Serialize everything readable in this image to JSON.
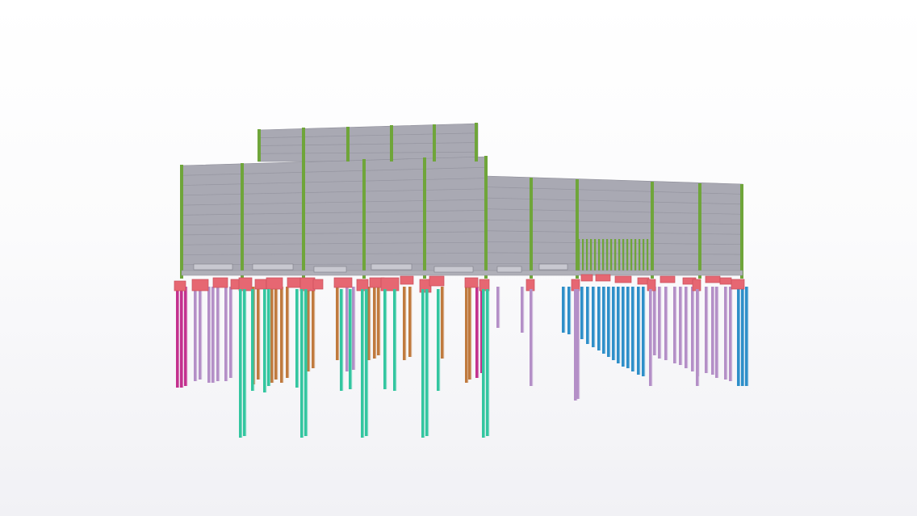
{
  "viewport": {
    "background_top": "#ffffff",
    "background_bottom": "#f1f1f5"
  },
  "model": {
    "elements": [
      {
        "name": "wall-panel",
        "color": "#a9a9b3"
      },
      {
        "name": "wall-panel-edge",
        "color": "#8d8d98"
      },
      {
        "name": "steel-column",
        "color": "#6fa53a"
      },
      {
        "name": "pile-cap",
        "color": "#e66772"
      },
      {
        "name": "pile-teal",
        "color": "#33c6a0"
      },
      {
        "name": "pile-lilac",
        "color": "#b48fc7"
      },
      {
        "name": "pile-magenta",
        "color": "#c3318e"
      },
      {
        "name": "pile-orange",
        "color": "#c07a3e"
      },
      {
        "name": "pile-blue",
        "color": "#2e8fc9"
      }
    ]
  }
}
